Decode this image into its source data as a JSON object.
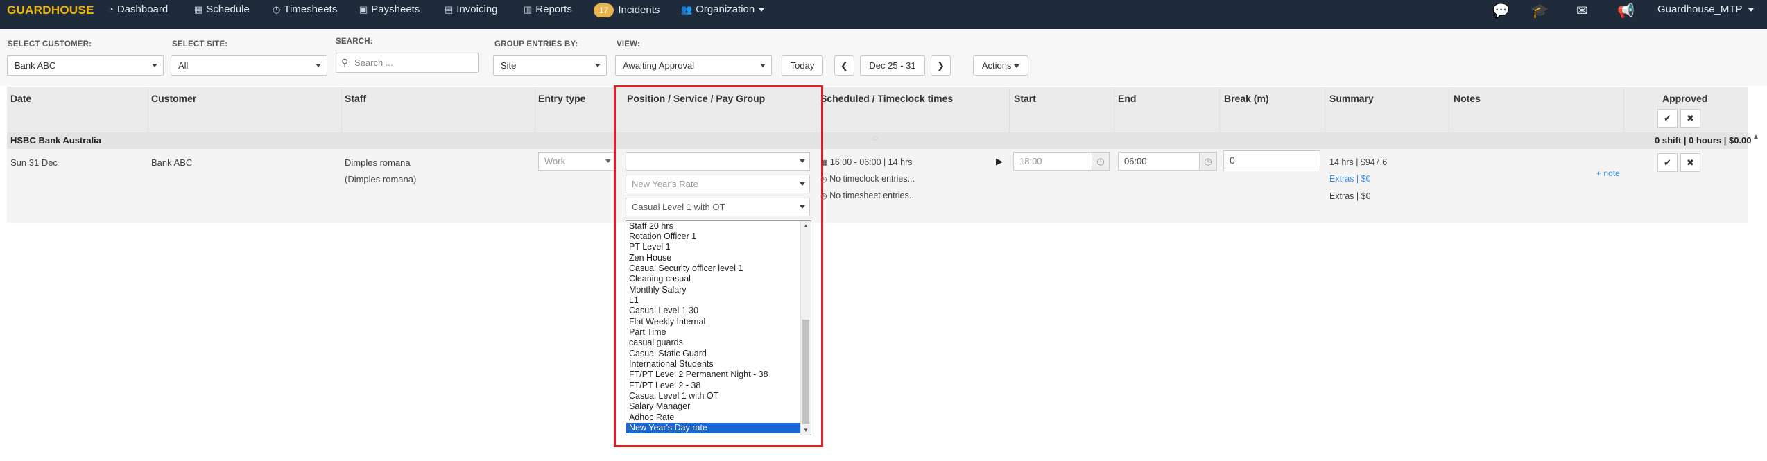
{
  "nav": {
    "brand": "GUARDHOUSE",
    "items": [
      {
        "label": "Dashboard",
        "icon": "dashboard-icon"
      },
      {
        "label": "Schedule",
        "icon": "calendar-icon"
      },
      {
        "label": "Timesheets",
        "icon": "clock-icon"
      },
      {
        "label": "Paysheets",
        "icon": "money-icon"
      },
      {
        "label": "Invoicing",
        "icon": "invoice-icon"
      },
      {
        "label": "Reports",
        "icon": "table-icon"
      },
      {
        "label": "Incidents",
        "badge": "17"
      },
      {
        "label": "Organization",
        "icon": "users-icon"
      }
    ],
    "user": "Guardhouse_MTP"
  },
  "filters": {
    "customer_label": "SELECT CUSTOMER:",
    "customer_value": "Bank ABC",
    "site_label": "SELECT SITE:",
    "site_value": "All",
    "search_label": "SEARCH:",
    "search_placeholder": "Search ...",
    "group_label": "GROUP ENTRIES BY:",
    "group_value": "Site",
    "view_label": "VIEW:",
    "view_value": "Awaiting Approval",
    "today": "Today",
    "range": "Dec 25 - 31",
    "actions": "Actions"
  },
  "table": {
    "headers": {
      "date": "Date",
      "customer": "Customer",
      "staff": "Staff",
      "entry_type": "Entry type",
      "position": "Position / Service / Pay Group",
      "scheduled": "Scheduled / Timeclock times",
      "start": "Start",
      "end": "End",
      "break": "Break (m)",
      "summary": "Summary",
      "notes": "Notes",
      "approved": "Approved"
    },
    "group": {
      "name": "HSBC Bank Australia",
      "totals": "0 shift | 0 hours | $0.00"
    },
    "row": {
      "date": "Sun 31 Dec",
      "customer": "Bank ABC",
      "staff": "Dimples romana",
      "staff_sub": "(Dimples romana)",
      "entry_type": "Work",
      "position_value": "",
      "service_value": "New Year's Rate",
      "paygroup_value": "Casual Level 1 with OT",
      "scheduled": "16:00 - 06:00 | 14 hrs",
      "timeclock": "No timeclock entries...",
      "timesheet": "No timesheet entries...",
      "start": "18:00",
      "end": "06:00",
      "break": "0",
      "summary": "14 hrs | $947.6",
      "extras_link": "Extras | $0",
      "extras": "Extras | $0",
      "note_link": "+ note"
    }
  },
  "dropdown": {
    "options": [
      "Staff 20 hrs",
      "Rotation Officer 1",
      "PT Level 1",
      "Zen House",
      "Casual Security officer level 1",
      "Cleaning casual",
      "Monthly Salary",
      "L1",
      "Casual Level 1 30",
      "Flat Weekly Internal",
      "Part Time",
      "casual guards",
      "Casual Static Guard",
      "International Students",
      "FT/PT Level 2 Permanent Night - 38",
      "FT/PT Level 2 - 38",
      "Casual Level 1 with OT",
      "Salary Manager",
      "Adhoc Rate"
    ],
    "selected": "New Year's Day rate"
  }
}
